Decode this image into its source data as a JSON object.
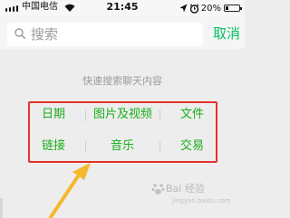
{
  "status_bar": {
    "carrier": "中国电信",
    "time": "21:45",
    "battery": "20%",
    "battery_level": 0.2
  },
  "search": {
    "placeholder": "搜索",
    "cancel_label": "取消"
  },
  "hint": "快速搜索聊天内容",
  "shortcuts": {
    "row1": [
      "日期",
      "图片及视频",
      "文件"
    ],
    "row2": [
      "链接",
      "音乐",
      "交易"
    ]
  },
  "watermark": {
    "text": "Bai 经验",
    "sub": "jingyan.baidu.com"
  },
  "colors": {
    "accent": "#07c160",
    "highlight_box": "#e5312b",
    "arrow": "#f5b82e"
  }
}
